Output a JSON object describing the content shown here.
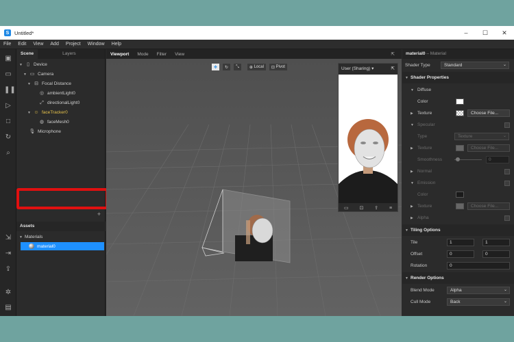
{
  "window": {
    "title": "Untitled*"
  },
  "menu": [
    "File",
    "Edit",
    "View",
    "Add",
    "Project",
    "Window",
    "Help"
  ],
  "scene_panel": {
    "tabs": [
      "Scene",
      "Layers"
    ],
    "tree": [
      {
        "label": "Device",
        "icon": "device-icon"
      },
      {
        "label": "Camera",
        "icon": "camera-icon"
      },
      {
        "label": "Focal Distance",
        "icon": "focal-distance-icon"
      },
      {
        "label": "ambientLight0",
        "icon": "ambient-light-icon"
      },
      {
        "label": "directionalLight0",
        "icon": "directional-light-icon"
      },
      {
        "label": "faceTracker0",
        "icon": "face-tracker-icon"
      },
      {
        "label": "faceMesh0",
        "icon": "face-mesh-icon"
      },
      {
        "label": "Microphone",
        "icon": "microphone-icon"
      }
    ]
  },
  "assets_panel": {
    "title": "Assets",
    "folder": "Materials",
    "item": "material0"
  },
  "viewport": {
    "tabs": [
      "Viewport",
      "Mode",
      "Filter",
      "View"
    ],
    "tools": {
      "local": "Local",
      "pivot": "Pivot"
    },
    "preview_device": "User (Sharing)"
  },
  "inspector": {
    "name": "material0",
    "type_suffix": "– Material",
    "shader_type_label": "Shader Type",
    "shader_type_value": "Standard",
    "shader_properties": "Shader Properties",
    "diffuse": "Diffuse",
    "color": "Color",
    "texture": "Texture",
    "choose_file": "Choose File...",
    "specular": "Specular",
    "type": "Type",
    "type_value": "Texture",
    "smoothness": "Smoothness",
    "smoothness_value": "0",
    "normal": "Normal",
    "emission": "Emission",
    "alpha": "Alpha",
    "tiling_options": "Tiling Options",
    "tile": "Tile",
    "tile_x": "1",
    "tile_y": "1",
    "offset": "Offset",
    "offset_x": "0",
    "offset_y": "0",
    "rotation": "Rotation",
    "rotation_value": "0",
    "render_options": "Render Options",
    "blend_mode": "Blend Mode",
    "blend_mode_value": "Alpha",
    "cull_mode": "Cull Mode",
    "cull_mode_value": "Back"
  },
  "colors": {
    "accent": "#1e90ff",
    "highlight_box": "#e01010",
    "face_tracker": "#e6c24b",
    "desktop": "#6fa39f"
  }
}
